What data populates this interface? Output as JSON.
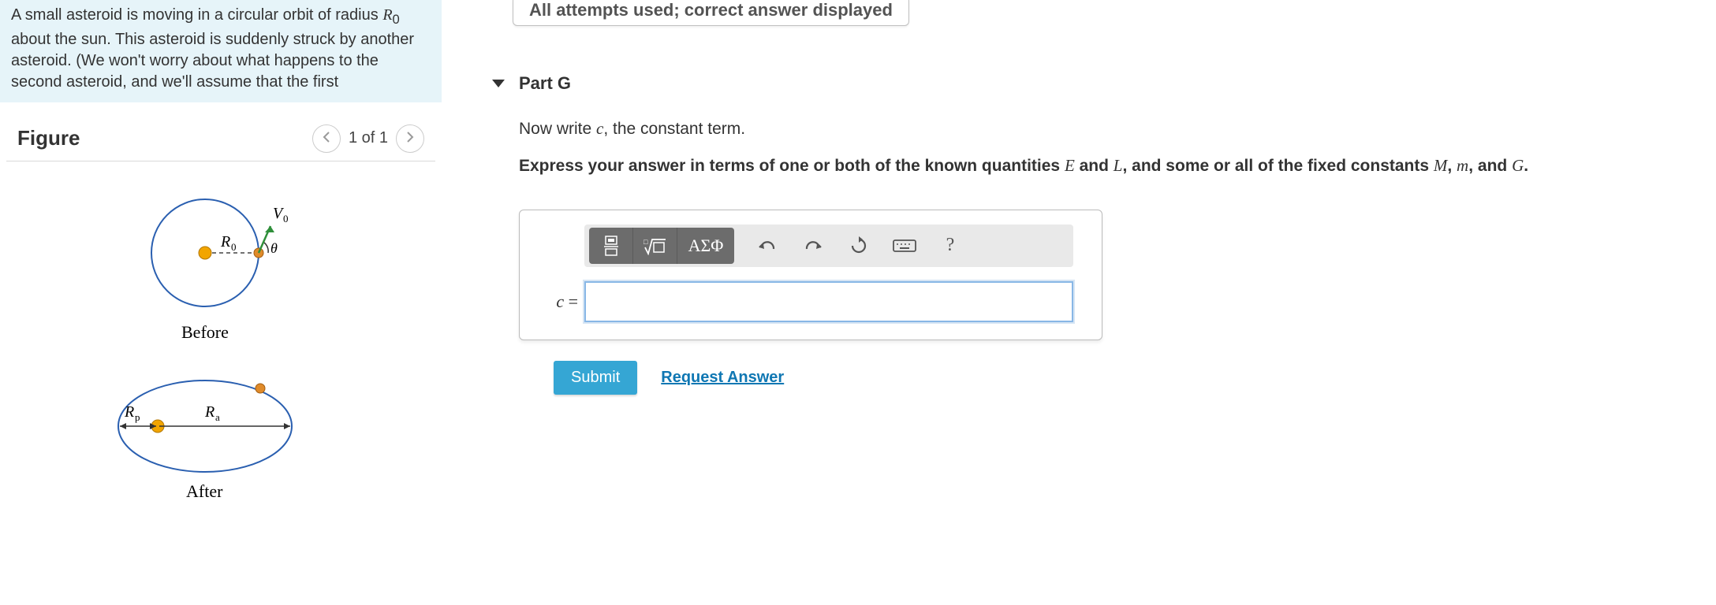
{
  "problem": {
    "text": "A small asteroid is moving in a circular orbit of radius R₀ about the sun. This asteroid is suddenly struck by another asteroid. (We won't worry about what happens to the second asteroid, and we'll assume that the first"
  },
  "figure": {
    "title": "Figure",
    "pager": "1 of 1",
    "labels": {
      "before": "Before",
      "after": "After",
      "R0": "R₀",
      "V0": "V₀",
      "theta": "θ",
      "Rp": "Rₚ",
      "Ra": "Rₐ"
    }
  },
  "status_banner": "All attempts used; correct answer displayed",
  "part": {
    "title": "Part G",
    "prompt_prefix": "Now write ",
    "prompt_var": "c",
    "prompt_suffix": ", the constant term.",
    "hint_1": "Express your answer in terms of one or both of the known quantities ",
    "hint_E": "E",
    "hint_and": " and ",
    "hint_L": "L",
    "hint_2": ", and some or all of the fixed constants ",
    "hint_M": "M",
    "hint_comma": ", ",
    "hint_m": "m",
    "hint_andG": ", and ",
    "hint_G": "G",
    "hint_period": "."
  },
  "toolbar": {
    "fraction_icon": "fraction-icon",
    "sqrt_icon": "sqrt-template-icon",
    "greek_label": "ΑΣΦ",
    "undo_icon": "undo-icon",
    "redo_icon": "redo-icon",
    "reset_icon": "reset-icon",
    "keyboard_icon": "keyboard-icon",
    "help_label": "?"
  },
  "answer": {
    "lhs_var": "c",
    "lhs_eq": " =",
    "value": ""
  },
  "actions": {
    "submit": "Submit",
    "request": "Request Answer"
  }
}
